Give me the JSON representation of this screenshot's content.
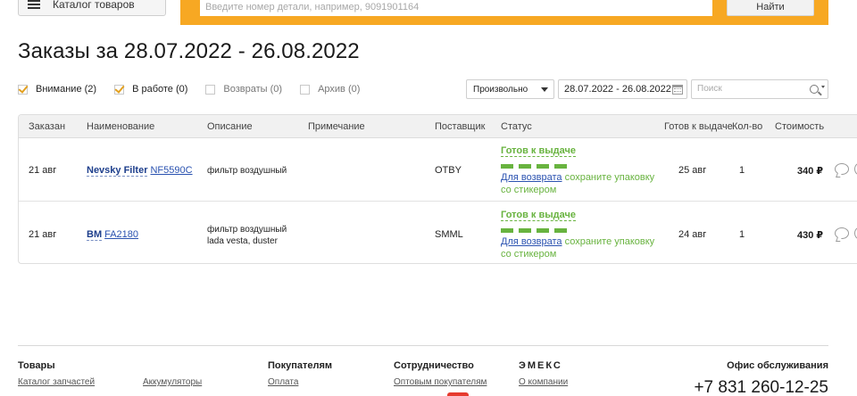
{
  "header": {
    "catalog_label": "Каталог товаров",
    "search_placeholder": "Введите номер детали, например, 9091901164",
    "find_label": "Найти",
    "accent_color": "#f7a823"
  },
  "page": {
    "title": "Заказы за 28.07.2022 - 26.08.2022"
  },
  "filters": [
    {
      "label": "Внимание (2)",
      "checked": true
    },
    {
      "label": "В работе (0)",
      "checked": true
    },
    {
      "label": "Возвраты (0)",
      "checked": false
    },
    {
      "label": "Архив (0)",
      "checked": false
    }
  ],
  "controls": {
    "sort_select": "Произвольно",
    "date_range": "28.07.2022 - 26.08.2022",
    "search_placeholder": "Поиск"
  },
  "table": {
    "columns": [
      "Заказан",
      "Наименование",
      "Описание",
      "Примечание",
      "Поставщик",
      "Статус",
      "Готов к выдаче",
      "Кол-во",
      "Стоимость"
    ],
    "rows": [
      {
        "ordered": "21 авг",
        "brand": "Nevsky Filter",
        "part_number": "NF5590C",
        "description_lines": [
          "фильтр воздушный",
          ""
        ],
        "note": "",
        "supplier": "OTBY",
        "status": "Готов к выдаче",
        "status_return_link": "Для возврата",
        "status_note": "сохраните упаковку со стикером",
        "ready": "25 авг",
        "qty": "1",
        "price": "340 ₽"
      },
      {
        "ordered": "21 авг",
        "brand": "BM",
        "part_number": "FA2180",
        "description_lines": [
          "фильтр воздушный",
          "lada vesta, duster"
        ],
        "note": "",
        "supplier": "SMML",
        "status": "Готов к выдаче",
        "status_return_link": "Для возврата",
        "status_note": "сохраните упаковку со стикером",
        "ready": "24 авг",
        "qty": "1",
        "price": "430 ₽"
      }
    ],
    "status_color": "#68b33f"
  },
  "footer": {
    "sections": [
      {
        "title": "Товары",
        "links": [
          "Каталог запчастей",
          "Аккумуляторы"
        ]
      },
      {
        "title": "Покупателям",
        "links": [
          "Оплата"
        ]
      },
      {
        "title": "Сотрудничество",
        "links": [
          "Оптовым покупателям"
        ]
      },
      {
        "title": "ЭМЕКС",
        "links": [
          "О компании"
        ]
      }
    ],
    "office_title": "Офис обслуживания",
    "phone": "+7 831 260-12-25"
  }
}
